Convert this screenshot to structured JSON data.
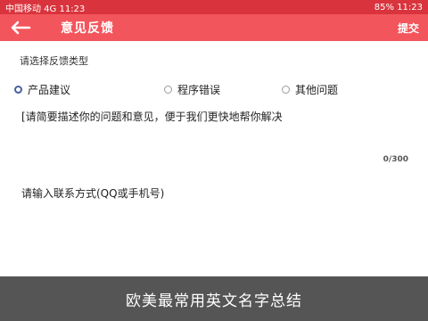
{
  "status_bar": {
    "left_text": "中国移动 4G 11:23",
    "right_text": "85% 11:23"
  },
  "toolbar": {
    "back_icon": "arrow-left-icon",
    "title": "意见反馈",
    "action_label": "提交"
  },
  "form": {
    "section_label": "请选择反馈类型",
    "options": [
      {
        "label": "产品建议",
        "checked": true
      },
      {
        "label": "程序错误",
        "checked": false
      },
      {
        "label": "其他问题",
        "checked": false
      }
    ],
    "description_placeholder": "[请简要描述你的问题和意见，便于我们更快地帮你解决",
    "counter": "0/300",
    "contact_placeholder": "请输入联系方式(QQ或手机号)"
  },
  "caption": "欧美最常用英文名字总结",
  "colors": {
    "status_bar": "#d9343d",
    "toolbar": "#f3555c",
    "radio_checked": "#4a5ea0",
    "caption_bg": "#464646"
  }
}
